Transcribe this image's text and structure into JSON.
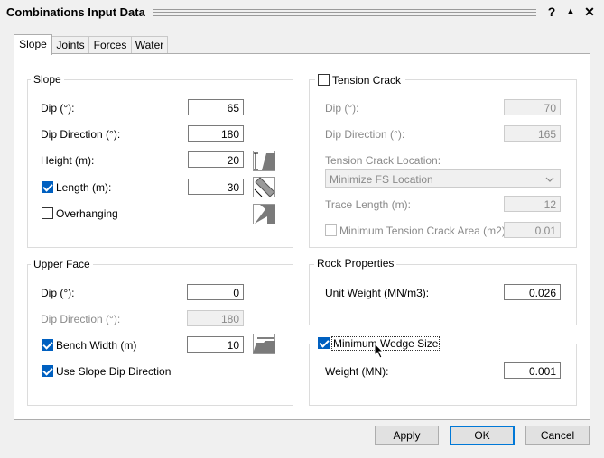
{
  "window": {
    "title": "Combinations Input Data",
    "help_label": "?",
    "collapse_label": "▲",
    "close_label": "✕"
  },
  "tabs": [
    "Slope",
    "Joints",
    "Forces",
    "Water"
  ],
  "slope_group": {
    "title": "Slope",
    "dip_label": "Dip (°):",
    "dip_value": "65",
    "dip_direction_label": "Dip Direction (°):",
    "dip_direction_value": "180",
    "height_label": "Height (m):",
    "height_value": "20",
    "length_label": "Length (m):",
    "length_value": "30",
    "length_checked": true,
    "overhanging_label": "Overhanging",
    "overhanging_checked": false
  },
  "tension_crack": {
    "title": "Tension Crack",
    "checked": false,
    "dip_label": "Dip (°):",
    "dip_value": "70",
    "dip_direction_label": "Dip Direction (°):",
    "dip_direction_value": "165",
    "location_label": "Tension Crack Location:",
    "location_value": "Minimize FS Location",
    "trace_length_label": "Trace Length (m):",
    "trace_length_value": "12",
    "min_area_label": "Minimum Tension Crack Area (m2):",
    "min_area_value": "0.01",
    "min_area_checked": false
  },
  "upper_face": {
    "title": "Upper Face",
    "dip_label": "Dip (°):",
    "dip_value": "0",
    "dip_direction_label": "Dip Direction (°):",
    "dip_direction_value": "180",
    "bench_width_label": "Bench Width (m)",
    "bench_width_value": "10",
    "bench_width_checked": true,
    "use_slope_dip_label": "Use Slope Dip Direction",
    "use_slope_dip_checked": true
  },
  "rock_properties": {
    "title": "Rock Properties",
    "unit_weight_label": "Unit Weight (MN/m3):",
    "unit_weight_value": "0.026"
  },
  "min_wedge": {
    "title": "Minimum Wedge Size",
    "checked": true,
    "weight_label": "Weight (MN):",
    "weight_value": "0.001"
  },
  "buttons": {
    "apply": "Apply",
    "ok": "OK",
    "cancel": "Cancel"
  },
  "colors": {
    "accent": "#0060c0",
    "default_button_border": "#0078d7"
  }
}
